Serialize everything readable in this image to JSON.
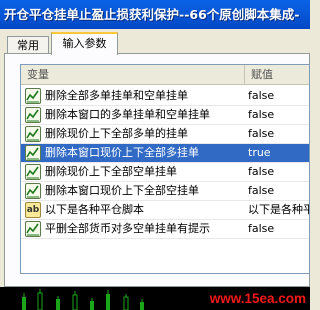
{
  "window": {
    "title": "开仓平仓挂单止盈止损获利保护--66个原创脚本集成-"
  },
  "tabs": [
    {
      "label": "常用"
    },
    {
      "label": "输入参数"
    }
  ],
  "grid": {
    "columns": [
      "变量",
      "赋值"
    ],
    "rows": [
      {
        "icon": "line-chart-icon",
        "name": "删除全部多单挂单和空单挂单",
        "value": "false",
        "selected": false
      },
      {
        "icon": "line-chart-icon",
        "name": "删除本窗口的多单挂单和空单挂单",
        "value": "false",
        "selected": false
      },
      {
        "icon": "line-chart-icon",
        "name": "删除现价上下全部多单的挂单",
        "value": "false",
        "selected": false
      },
      {
        "icon": "line-chart-icon",
        "name": "删除本窗口现价上下全部多挂单",
        "value": "true",
        "selected": true
      },
      {
        "icon": "line-chart-icon",
        "name": "删除现价上下全部空单挂单",
        "value": "false",
        "selected": false
      },
      {
        "icon": "line-chart-icon",
        "name": "删除本窗口现价上下全部空挂单",
        "value": "false",
        "selected": false
      },
      {
        "icon": "ab-text-icon",
        "name": "以下是各种平仓脚本",
        "value": "以下是各种平仓",
        "selected": false
      },
      {
        "icon": "line-chart-icon",
        "name": "平删全部货币对多空单挂单有提示",
        "value": "false",
        "selected": false
      }
    ]
  },
  "watermark": "www.15ea.com",
  "colors": {
    "selection": "#316ac5",
    "title_bar": "#0858d9",
    "watermark": "#f01818",
    "tab_highlight": "#ffc83c"
  }
}
